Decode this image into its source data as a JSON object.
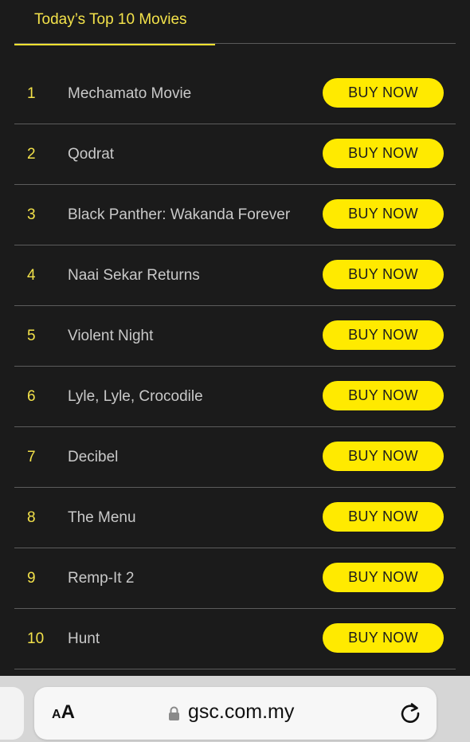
{
  "tab": {
    "label": "Today’s Top 10 Movies"
  },
  "movies": [
    {
      "rank": "1",
      "title": "Mechamato Movie",
      "cta": "BUY NOW"
    },
    {
      "rank": "2",
      "title": "Qodrat",
      "cta": "BUY NOW"
    },
    {
      "rank": "3",
      "title": "Black Panther: Wakanda Forever",
      "cta": "BUY NOW"
    },
    {
      "rank": "4",
      "title": "Naai Sekar Returns",
      "cta": "BUY NOW"
    },
    {
      "rank": "5",
      "title": "Violent Night",
      "cta": "BUY NOW"
    },
    {
      "rank": "6",
      "title": "Lyle, Lyle, Crocodile",
      "cta": "BUY NOW"
    },
    {
      "rank": "7",
      "title": "Decibel",
      "cta": "BUY NOW"
    },
    {
      "rank": "8",
      "title": "The Menu",
      "cta": "BUY NOW"
    },
    {
      "rank": "9",
      "title": "Remp-It 2",
      "cta": "BUY NOW"
    },
    {
      "rank": "10",
      "title": "Hunt",
      "cta": "BUY NOW"
    }
  ],
  "browser": {
    "text_size_label": "AA",
    "url": "gsc.com.my",
    "lock_icon": "lock-icon",
    "reload_icon": "reload-icon"
  },
  "colors": {
    "accent": "#ffea00",
    "rank_text": "#f3e24a",
    "background": "#1b1b1b"
  }
}
